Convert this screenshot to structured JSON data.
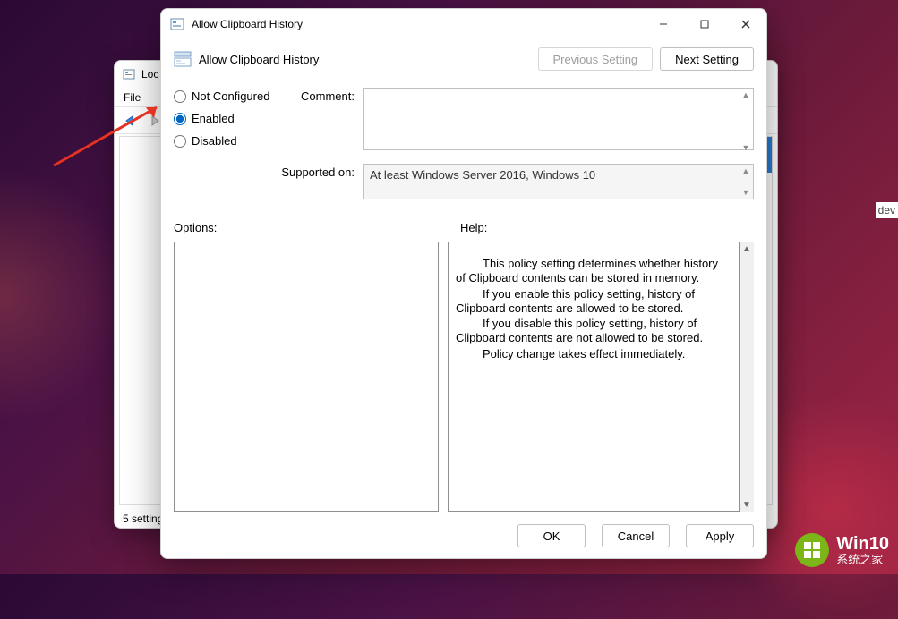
{
  "parent_window": {
    "title_partial": "Loc",
    "menu_file": "File",
    "status": "5 setting"
  },
  "dialog": {
    "title": "Allow Clipboard History",
    "policy_name": "Allow Clipboard History",
    "prev_btn": "Previous Setting",
    "next_btn": "Next Setting",
    "radio": {
      "not_configured": "Not Configured",
      "enabled": "Enabled",
      "disabled": "Disabled",
      "selected": "enabled"
    },
    "comment_label": "Comment:",
    "comment_value": "",
    "supported_label": "Supported on:",
    "supported_value": "At least Windows Server 2016, Windows 10",
    "options_label": "Options:",
    "help_label": "Help:",
    "help_text": {
      "p1": "This policy setting determines whether history of Clipboard contents can be stored in memory.",
      "p2": "If you enable this policy setting, history of Clipboard contents are allowed to be stored.",
      "p3": "If you disable this policy setting, history of Clipboard contents are not allowed to be stored.",
      "p4": "Policy change takes effect immediately."
    },
    "ok_btn": "OK",
    "cancel_btn": "Cancel",
    "apply_btn": "Apply"
  },
  "fragment_right": "dev",
  "watermark": {
    "big": "Win10",
    "small": "系统之家"
  }
}
